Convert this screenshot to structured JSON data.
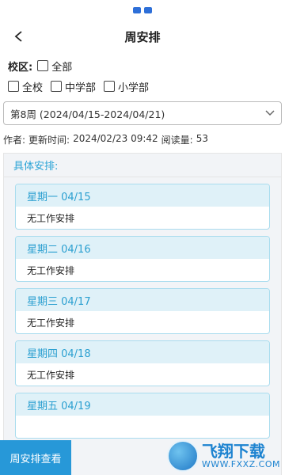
{
  "header": {
    "title": "周安排",
    "back_icon": "chevron-left-icon"
  },
  "filters": {
    "campus_label": "校区:",
    "all_label": "全部",
    "options": [
      "全校",
      "中学部",
      "小学部"
    ]
  },
  "week_select": {
    "value": "第8周 (2024/04/15-2024/04/21)"
  },
  "meta": {
    "author_label": "作者:",
    "updated_label": "更新时间:",
    "updated_value": "2024/02/23 09:42",
    "views_label": "阅读量:",
    "views_value": "53"
  },
  "schedule": {
    "header": "具体安排:",
    "days": [
      {
        "title": "星期一 04/15",
        "content": "无工作安排"
      },
      {
        "title": "星期二 04/16",
        "content": "无工作安排"
      },
      {
        "title": "星期三 04/17",
        "content": "无工作安排"
      },
      {
        "title": "星期四 04/18",
        "content": "无工作安排"
      },
      {
        "title": "星期五 04/19",
        "content": ""
      }
    ]
  },
  "footer": {
    "view_button": "周安排查看"
  },
  "watermark": {
    "name": "飞翔下载",
    "url": "WWW.FXXZ.COM"
  },
  "colors": {
    "accent": "#2aa3d6",
    "button": "#2798d8",
    "day_title_bg": "#dff1f8"
  }
}
